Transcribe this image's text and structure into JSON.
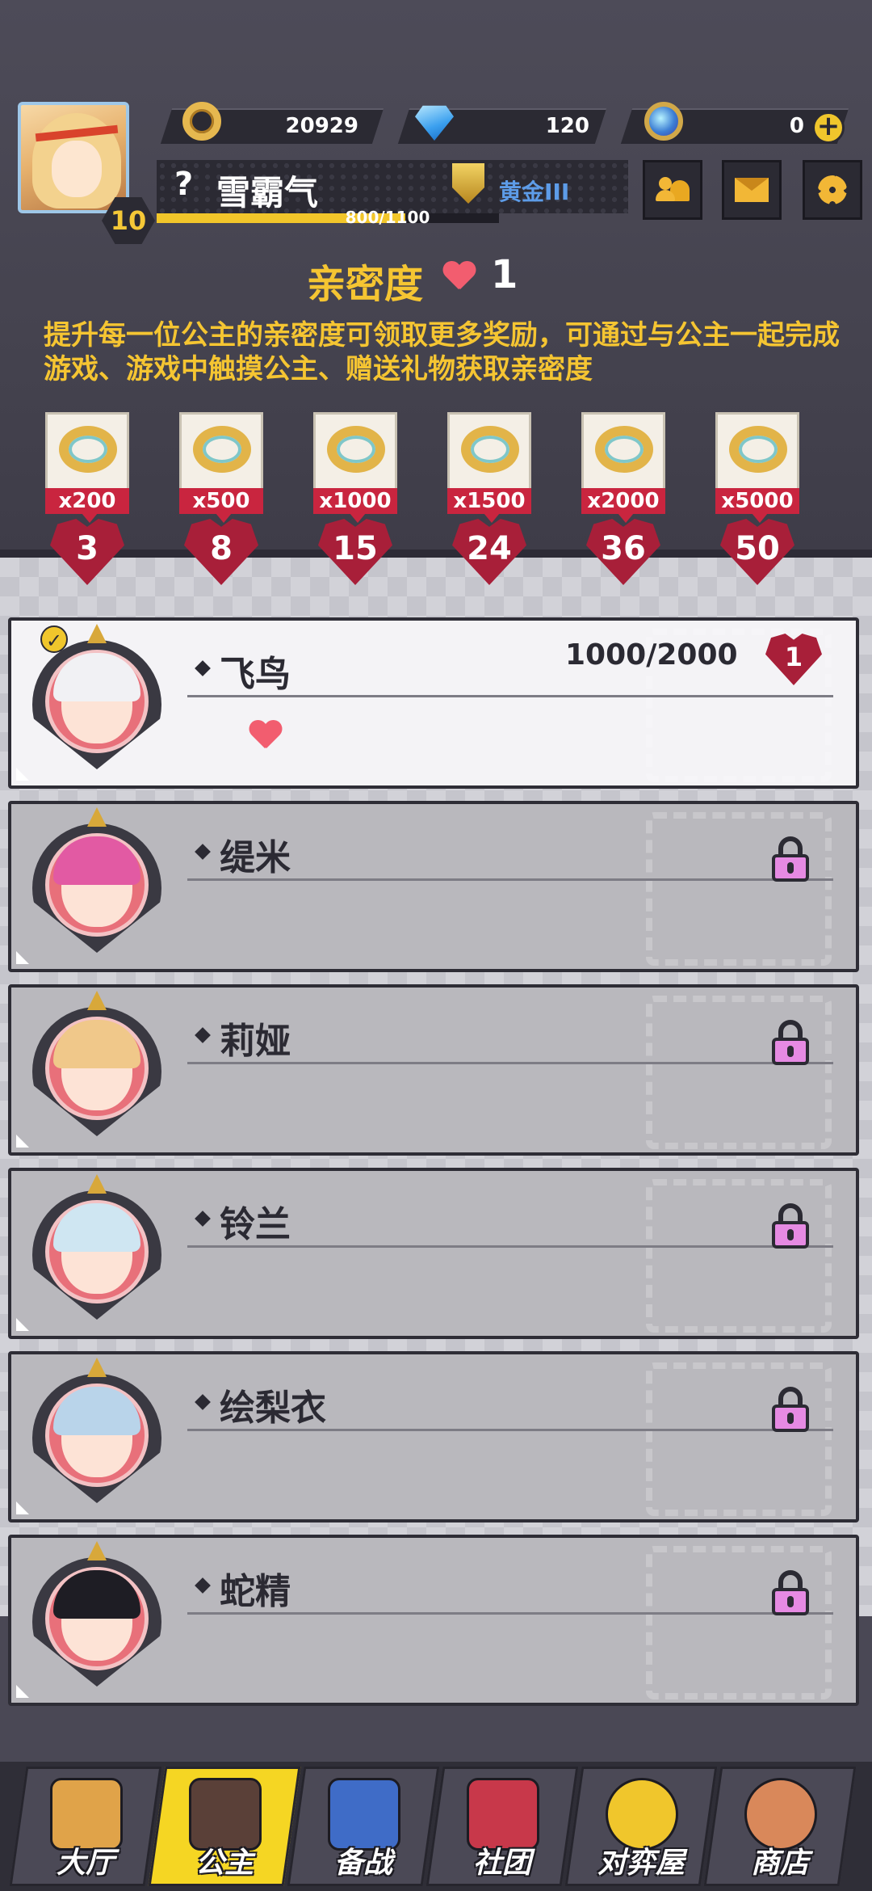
{
  "header": {
    "player_name": "雪霸气",
    "unknown_marker": "?",
    "level": "10",
    "rank": "黄金III",
    "xp_text": "800/1100",
    "xp_fraction": 0.727
  },
  "currencies": {
    "coins": "20929",
    "diamonds": "120",
    "tickets": "0",
    "add_symbol": "+"
  },
  "intimacy": {
    "title": "亲密度",
    "count": "1",
    "description": "提升每一位公主的亲密度可领取更多奖励，可通过与公主一起完成游戏、游戏中触摸公主、赠送礼物获取亲密度"
  },
  "rewards": [
    {
      "qty": "x200",
      "req": "3"
    },
    {
      "qty": "x500",
      "req": "8"
    },
    {
      "qty": "x1000",
      "req": "15"
    },
    {
      "qty": "x1500",
      "req": "24"
    },
    {
      "qty": "x2000",
      "req": "36"
    },
    {
      "qty": "x5000",
      "req": "50"
    }
  ],
  "princesses": [
    {
      "name": "飞鸟",
      "progress": "1000/2000",
      "level": "1",
      "hearts": 1,
      "locked": false,
      "check": "✓"
    },
    {
      "name": "缇米",
      "locked": true
    },
    {
      "name": "莉娅",
      "locked": true
    },
    {
      "name": "铃兰",
      "locked": true
    },
    {
      "name": "绘梨衣",
      "locked": true
    },
    {
      "name": "蛇精",
      "locked": true
    }
  ],
  "nav": [
    {
      "label": "大厅",
      "icon": "crossed-swords-icon",
      "active": false
    },
    {
      "label": "公主",
      "icon": "princess-icon",
      "active": true
    },
    {
      "label": "备战",
      "icon": "chess-icon",
      "active": false
    },
    {
      "label": "社团",
      "icon": "castle-icon",
      "active": false
    },
    {
      "label": "对弈屋",
      "icon": "globe-icon",
      "active": false
    },
    {
      "label": "商店",
      "icon": "shop-icon",
      "active": false
    }
  ],
  "colors": {
    "accent_gold": "#f5c532",
    "heart_red": "#a81f39",
    "lock_pink": "#e68ae3",
    "rank_blue": "#5d9ce8"
  }
}
